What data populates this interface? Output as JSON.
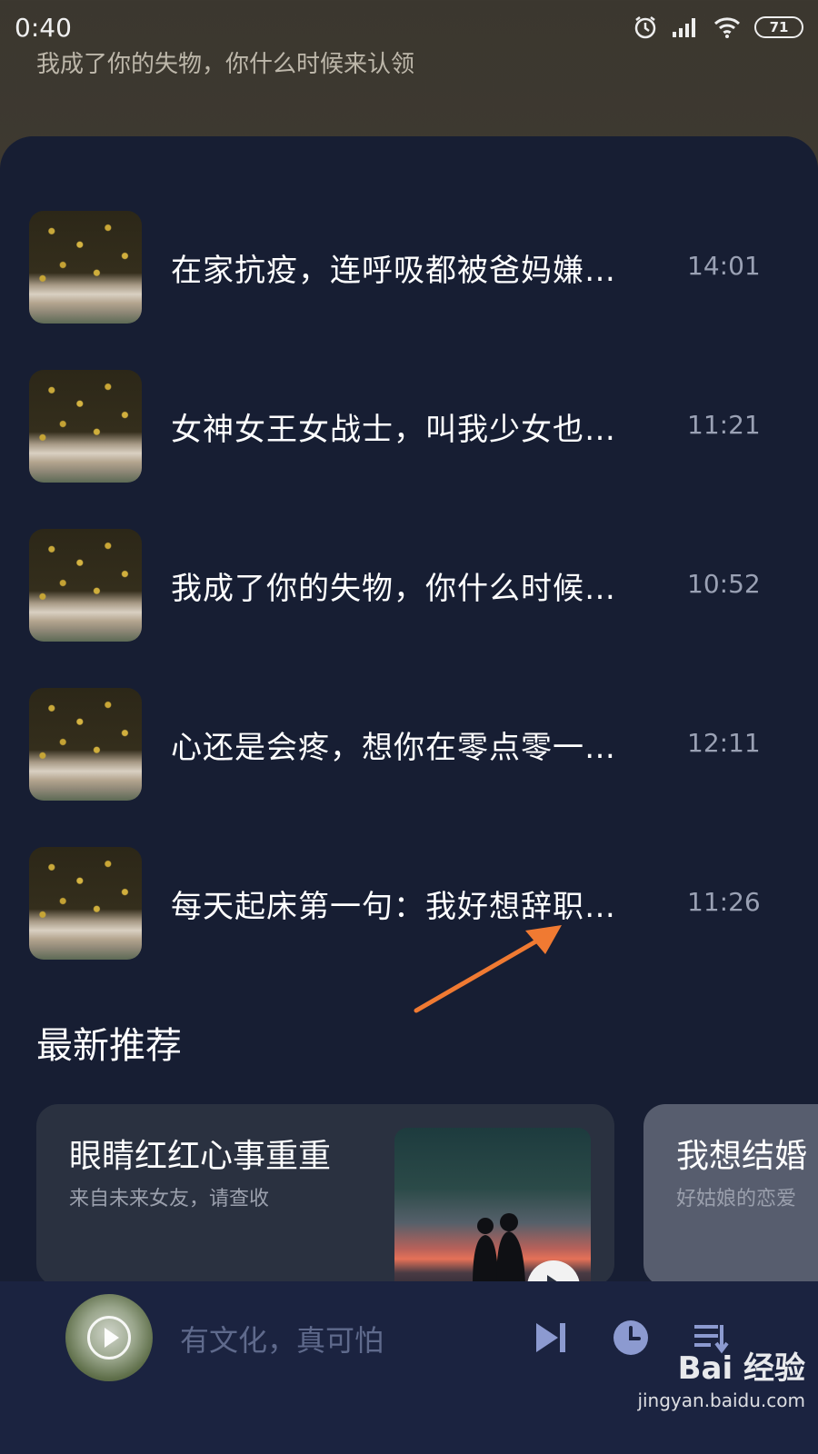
{
  "status_bar": {
    "time": "0:40",
    "battery": "71",
    "icons": [
      "alarm-icon",
      "signal-icon",
      "wifi-icon",
      "battery-icon"
    ]
  },
  "header": {
    "subtitle": "我成了你的失物，你什么时候来认领"
  },
  "song_list": [
    {
      "title": "在家抗疫，连呼吸都被爸妈嫌…",
      "time": "14:01"
    },
    {
      "title": "女神女王女战士，叫我少女也…",
      "time": "11:21"
    },
    {
      "title": "我成了你的失物，你什么时候…",
      "time": "10:52"
    },
    {
      "title": "心还是会疼，想你在零点零一…",
      "time": "12:11"
    },
    {
      "title": "每天起床第一句：我好想辞职…",
      "time": "11:26"
    }
  ],
  "recommend": {
    "section_title": "最新推荐",
    "cards": [
      {
        "title": "眼睛红红心事重重",
        "subtitle": "来自未来女友，请查收"
      },
      {
        "title": "我想结婚",
        "subtitle": "好姑娘的恋爱"
      }
    ]
  },
  "player": {
    "title": "有文化，真可怕",
    "controls": [
      "next-icon",
      "timer-icon",
      "playlist-icon"
    ]
  },
  "watermark": {
    "logo": "Bai 经验",
    "url": "jingyan.baidu.com"
  },
  "colors": {
    "sheet_bg": "#171e33",
    "player_bg": "#1b2340",
    "accent_arrow": "#f07a32",
    "control_icon": "#8c9ad0"
  }
}
